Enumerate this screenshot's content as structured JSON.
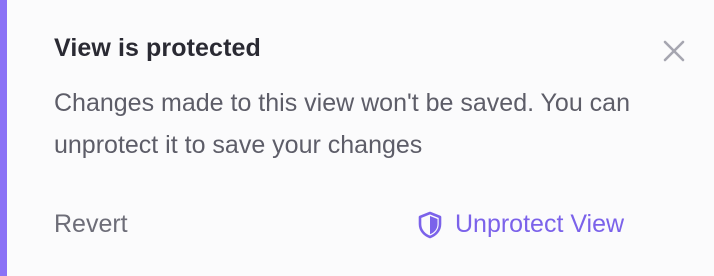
{
  "notification": {
    "title": "View is protected",
    "message": "Changes made to this view won't be saved. You can unprotect it to save your changes",
    "revert_label": "Revert",
    "unprotect_label": "Unprotect View",
    "close_icon": "close-icon",
    "shield_icon": "shield-icon",
    "accent_color": "#8b72f6",
    "action_color": "#7b62ea"
  }
}
